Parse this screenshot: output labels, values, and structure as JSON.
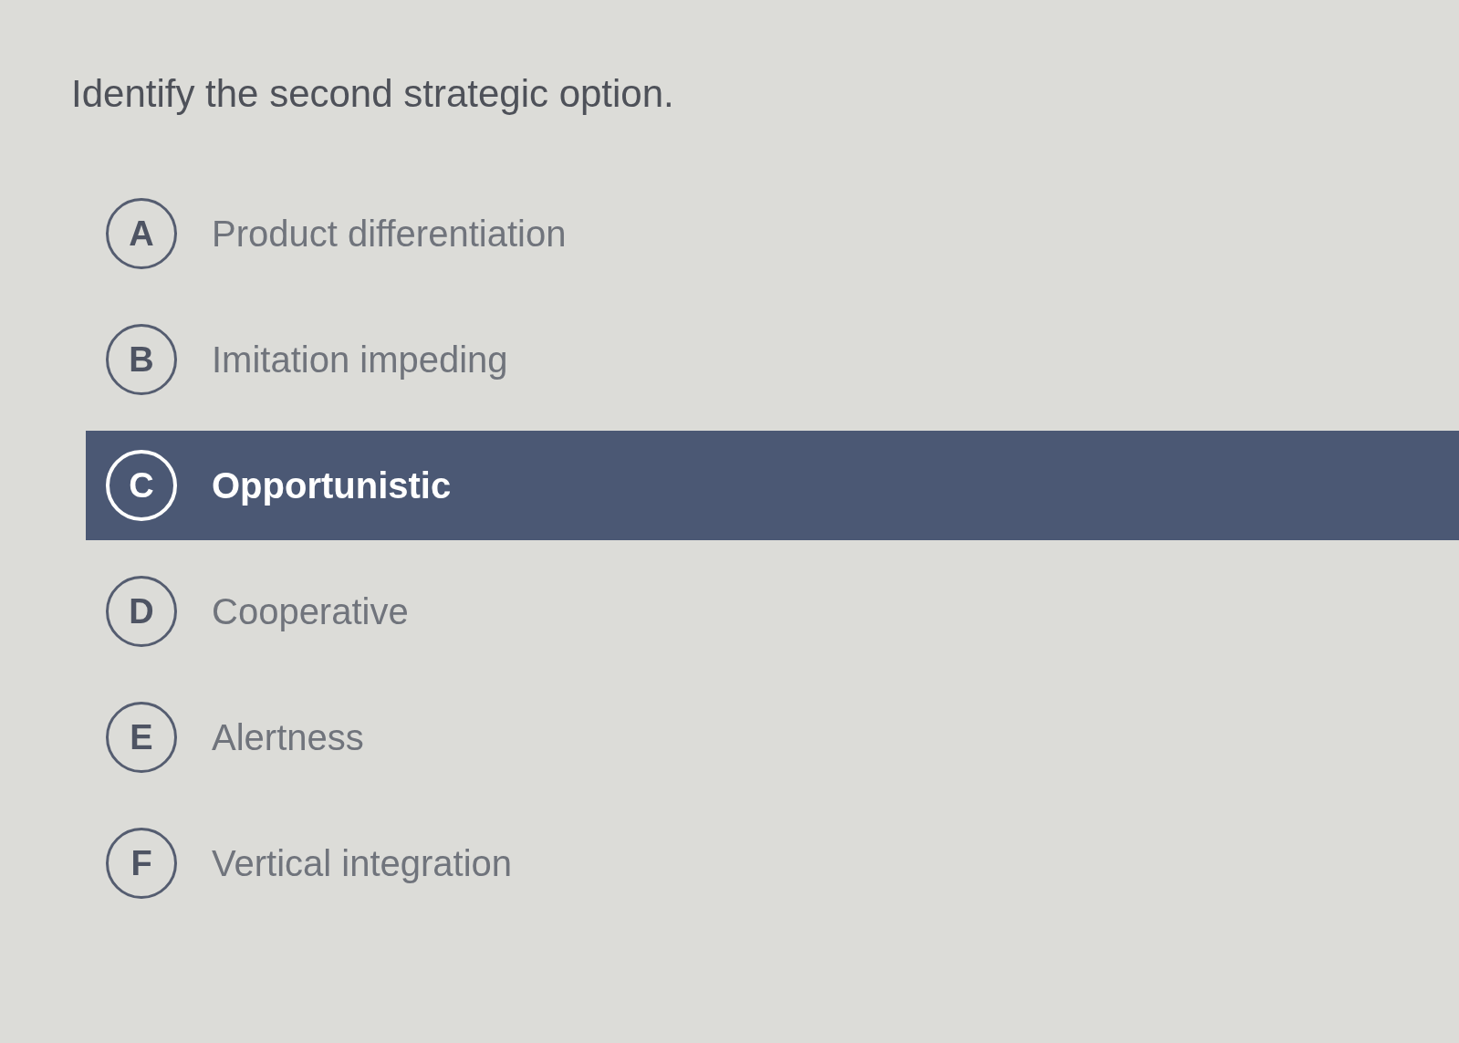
{
  "question": "Identify the second strategic option.",
  "options": [
    {
      "letter": "A",
      "label": "Product differentiation",
      "selected": false
    },
    {
      "letter": "B",
      "label": "Imitation impeding",
      "selected": false
    },
    {
      "letter": "C",
      "label": "Opportunistic",
      "selected": true
    },
    {
      "letter": "D",
      "label": "Cooperative",
      "selected": false
    },
    {
      "letter": "E",
      "label": "Alertness",
      "selected": false
    },
    {
      "letter": "F",
      "label": "Vertical integration",
      "selected": false
    }
  ]
}
